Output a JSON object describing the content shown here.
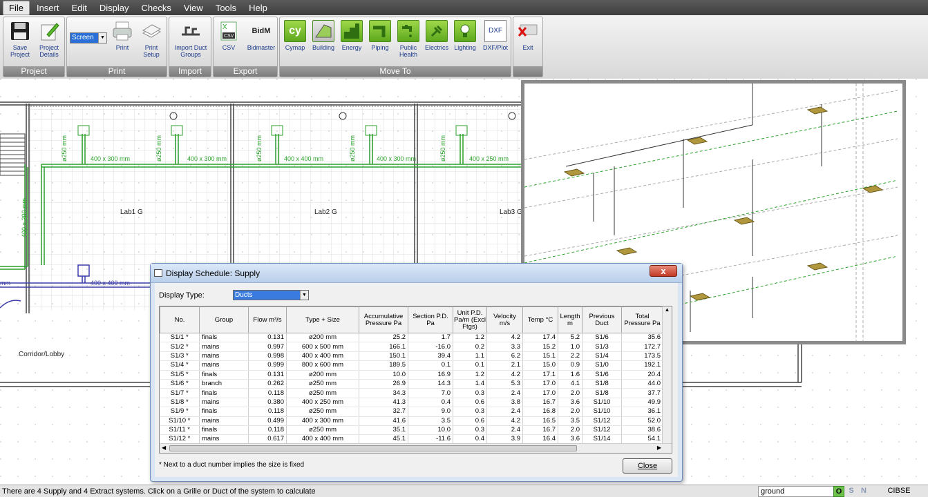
{
  "menu": [
    "File",
    "Insert",
    "Edit",
    "Display",
    "Checks",
    "View",
    "Tools",
    "Help"
  ],
  "ribbon": {
    "groups": {
      "project": "Project",
      "print": "Print",
      "import": "Import",
      "export": "Export",
      "moveto": "Move To"
    },
    "buttons": {
      "save": "Save Project",
      "details": "Project Details",
      "screen": "Screen",
      "print": "Print",
      "setup": "Print Setup",
      "import": "Import Duct Groups",
      "csv": "CSV",
      "bidmaster": "Bidmaster",
      "cymap": "Cymap",
      "building": "Building",
      "energy": "Energy",
      "piping": "Piping",
      "public_health": "Public Health",
      "electrics": "Electrics",
      "lighting": "Lighting",
      "dxf": "DXF/Plot",
      "exit": "Exit"
    },
    "icon_text": {
      "csv": "CSV",
      "bidm": "BidM",
      "cy": "cy",
      "dxf": "DXF"
    }
  },
  "drawing": {
    "rooms": [
      "Lab1 G",
      "Lab2 G",
      "Lab3 G",
      "Corridor/Lobby"
    ],
    "duct_labels": [
      "400 x 300 mm",
      "400 x 300 mm",
      "400 x 400 mm",
      "400 x 300 mm",
      "400 x 250 mm",
      "400 x 400 mm",
      "400 x 200 mm"
    ],
    "pipe_labels": [
      "ø250 mm",
      "ø250 mm",
      "ø250 mm",
      "ø250 mm",
      "ø250 mm"
    ],
    "edge_label": "mm"
  },
  "dialog": {
    "title": "Display Schedule: Supply",
    "close_x": "x",
    "display_type_label": "Display Type:",
    "display_type_value": "Ducts",
    "footnote": "* Next to a duct number implies the size is fixed",
    "close_button": "Close",
    "columns": [
      "No.",
      "Group",
      "Flow m³/s",
      "Type + Size",
      "Accumulative Pressure Pa",
      "Section P.D. Pa",
      "Unit P.D. Pa/m (Excl Ftgs)",
      "Velocity m/s",
      "Temp °C",
      "Length m",
      "Previous Duct",
      "Total Pressure Pa"
    ],
    "rows": [
      [
        "S1/1 *",
        "finals",
        "0.131",
        "ø200 mm",
        "25.2",
        "1.7",
        "1.2",
        "4.2",
        "17.4",
        "5.2",
        "S1/6",
        "35.6"
      ],
      [
        "S1/2 *",
        "mains",
        "0.997",
        "600 x 500 mm",
        "166.1",
        "-16.0",
        "0.2",
        "3.3",
        "15.2",
        "1.0",
        "S1/3",
        "172.7"
      ],
      [
        "S1/3 *",
        "mains",
        "0.998",
        "400 x 400 mm",
        "150.1",
        "39.4",
        "1.1",
        "6.2",
        "15.1",
        "2.2",
        "S1/4",
        "173.5"
      ],
      [
        "S1/4 *",
        "mains",
        "0.999",
        "800 x 600 mm",
        "189.5",
        "0.1",
        "0.1",
        "2.1",
        "15.0",
        "0.9",
        "S1/0",
        "192.1"
      ],
      [
        "S1/5 *",
        "finals",
        "0.131",
        "ø200 mm",
        "10.0",
        "16.9",
        "1.2",
        "4.2",
        "17.1",
        "1.6",
        "S1/6",
        "20.4"
      ],
      [
        "S1/6 *",
        "branch",
        "0.262",
        "ø250 mm",
        "26.9",
        "14.3",
        "1.4",
        "5.3",
        "17.0",
        "4.1",
        "S1/8",
        "44.0"
      ],
      [
        "S1/7 *",
        "finals",
        "0.118",
        "ø250 mm",
        "34.3",
        "7.0",
        "0.3",
        "2.4",
        "17.0",
        "2.0",
        "S1/8",
        "37.7"
      ],
      [
        "S1/8 *",
        "mains",
        "0.380",
        "400 x 250 mm",
        "41.3",
        "0.4",
        "0.6",
        "3.8",
        "16.7",
        "3.6",
        "S1/10",
        "49.9"
      ],
      [
        "S1/9 *",
        "finals",
        "0.118",
        "ø250 mm",
        "32.7",
        "9.0",
        "0.3",
        "2.4",
        "16.8",
        "2.0",
        "S1/10",
        "36.1"
      ],
      [
        "S1/10 *",
        "mains",
        "0.499",
        "400 x 300 mm",
        "41.6",
        "3.5",
        "0.6",
        "4.2",
        "16.5",
        "3.5",
        "S1/12",
        "52.0"
      ],
      [
        "S1/11 *",
        "finals",
        "0.118",
        "ø250 mm",
        "35.1",
        "10.0",
        "0.3",
        "2.4",
        "16.7",
        "2.0",
        "S1/12",
        "38.6"
      ],
      [
        "S1/12 *",
        "mains",
        "0.617",
        "400 x 400 mm",
        "45.1",
        "-11.6",
        "0.4",
        "3.9",
        "16.4",
        "3.6",
        "S1/14",
        "54.1"
      ]
    ]
  },
  "status": {
    "message": "There are 4 Supply and 4 Extract systems.  Click on a Grille or Duct of the system to calculate",
    "layer": "ground",
    "snaps": [
      "O",
      "S",
      "N"
    ],
    "standard": "CIBSE"
  },
  "colors": {
    "duct_green": "#2aa12a",
    "duct_blue": "#3c3ca8",
    "grid": "#d4d4d4",
    "wall": "#444444",
    "diffuser": "#b0963c"
  }
}
